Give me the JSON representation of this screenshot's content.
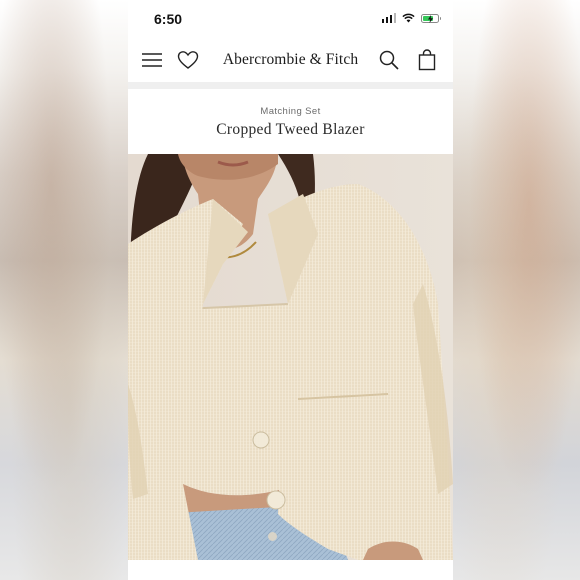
{
  "status_bar": {
    "time": "6:50",
    "battery_color": "#35c759"
  },
  "nav": {
    "brand": "Abercrombie & Fitch",
    "icons": [
      "menu-icon",
      "heart-icon",
      "search-icon",
      "shopping-bag-icon"
    ]
  },
  "product": {
    "eyebrow": "Matching Set",
    "title": "Cropped Tweed Blazer",
    "image": "model wearing cream cropped tweed blazer over matching crop top with light wash jeans"
  },
  "colors": {
    "jacket": "#efe3cd",
    "background": "#e6ddd2",
    "jeans": "#a9c0d6"
  }
}
